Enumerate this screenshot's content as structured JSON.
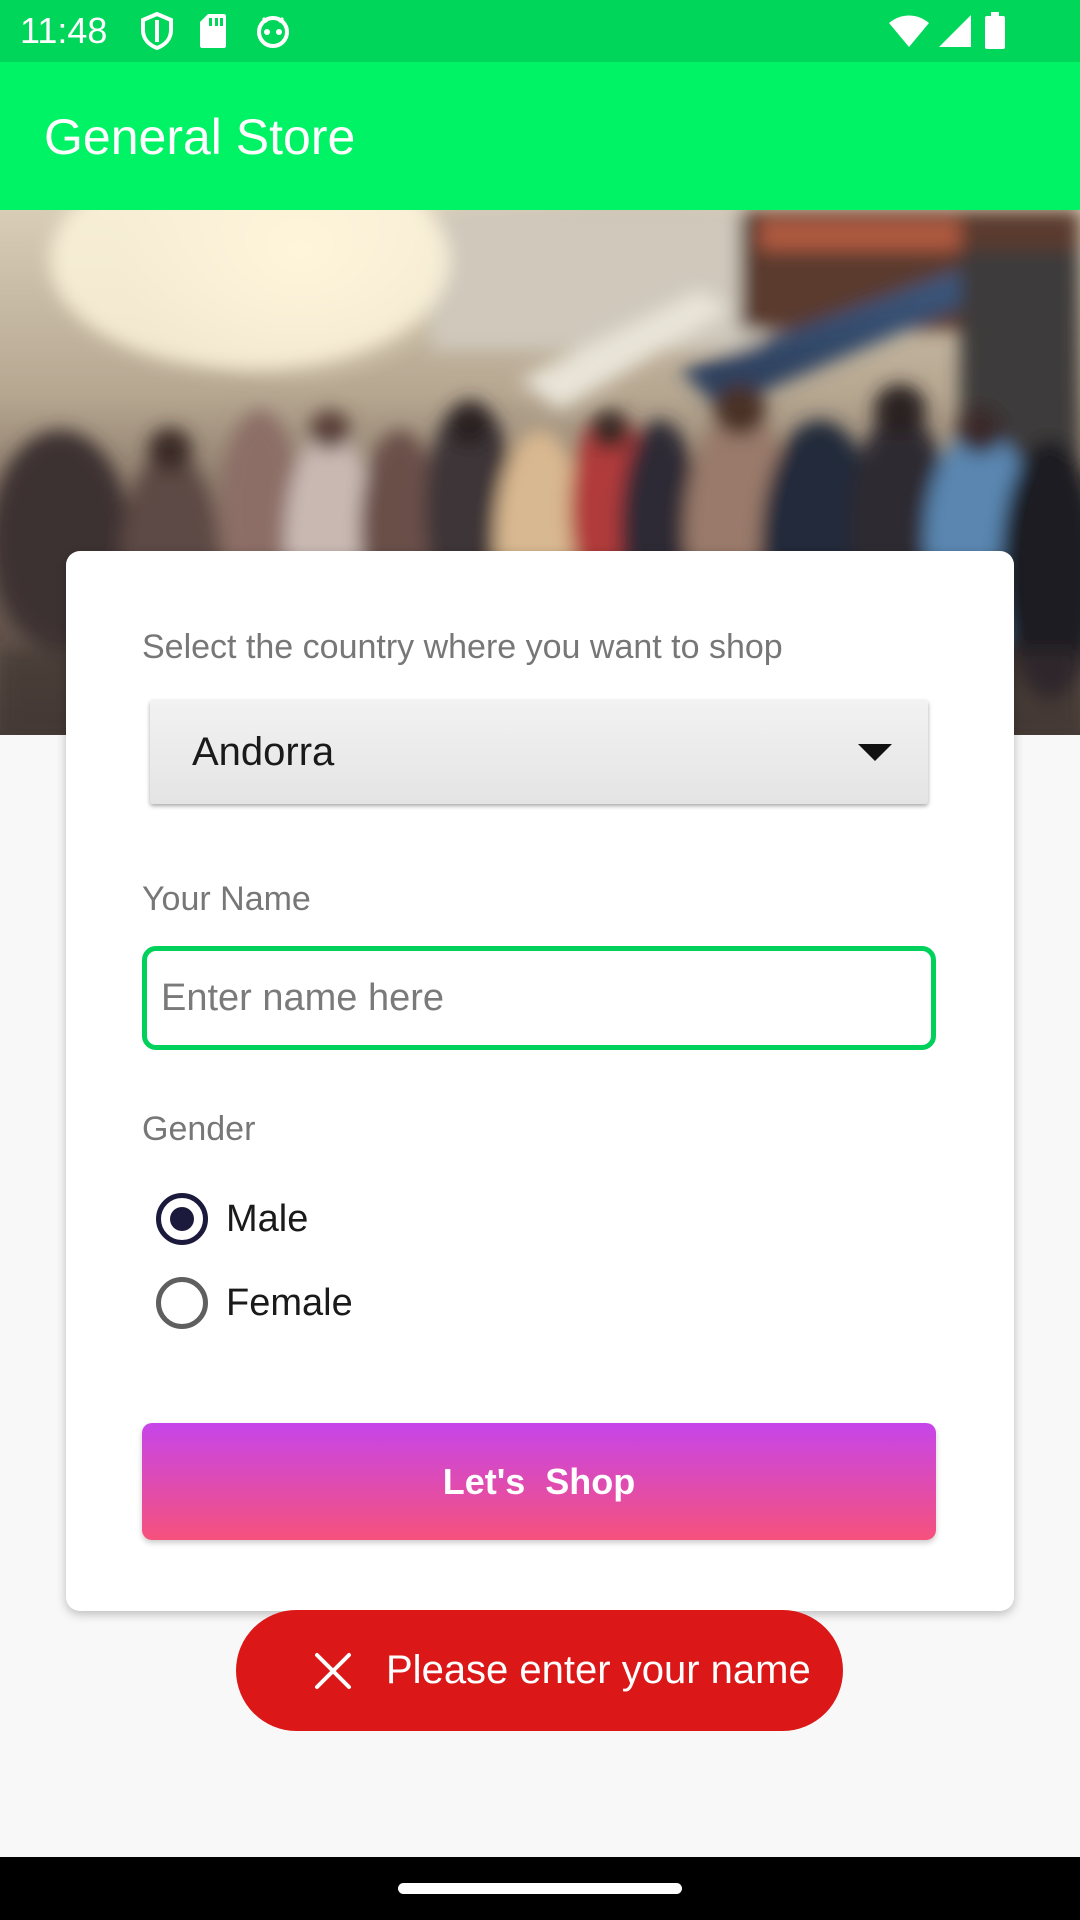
{
  "status_bar": {
    "time": "11:48",
    "left_icons": [
      "shield-icon",
      "sd-card-icon",
      "android-debug-icon"
    ],
    "right_icons": [
      "wifi-icon",
      "signal-icon",
      "battery-icon"
    ]
  },
  "app_bar": {
    "title": "General Store",
    "color": "#00f265"
  },
  "hero": {
    "image": "blurred-street-crowd-photo"
  },
  "form": {
    "country_label": "Select the country where you want to shop",
    "country_selected": "Andorra",
    "name_label": "Your Name",
    "name_value": "",
    "name_placeholder": "Enter name here",
    "gender_label": "Gender",
    "gender_options": [
      {
        "label": "Male",
        "checked": true
      },
      {
        "label": "Female",
        "checked": false
      }
    ],
    "submit_label": "Let's  Shop",
    "accent_color": "#00d15a"
  },
  "toast": {
    "icon": "close-icon",
    "message": "Please enter your name",
    "color": "#dc1717"
  }
}
